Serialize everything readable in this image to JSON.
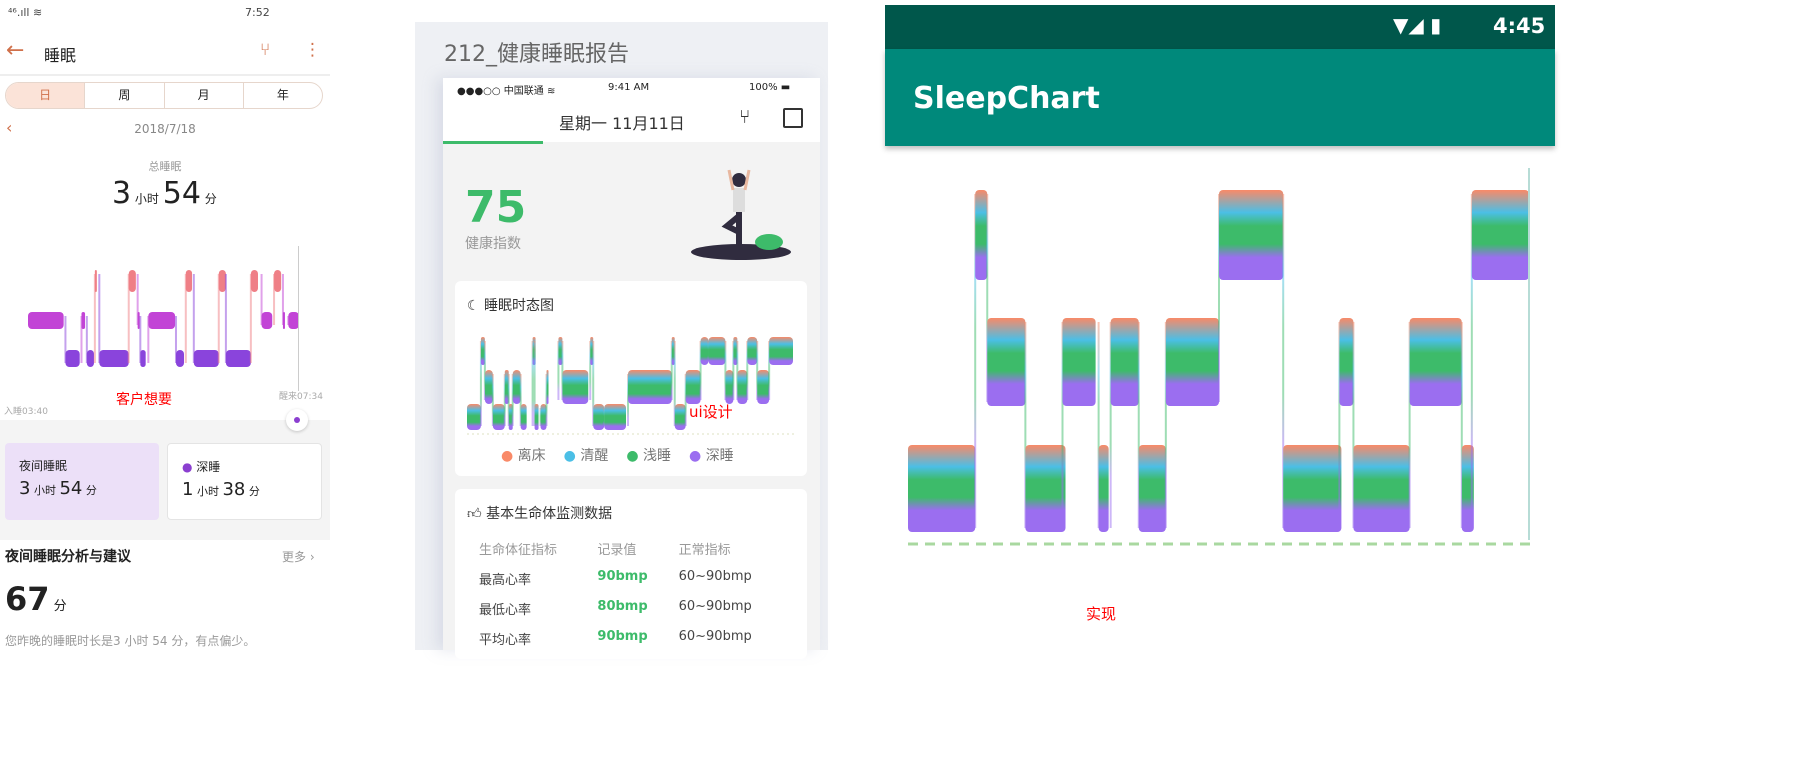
{
  "left": {
    "status_time": "7:52",
    "title": "睡眠",
    "tabs": [
      "日",
      "周",
      "月",
      "年"
    ],
    "date": "2018/7/18",
    "total_label": "总睡眠",
    "total_hours": "3",
    "hour_unit": "小时",
    "total_minutes": "54",
    "minute_unit": "分",
    "sleep_start": "入睡03:40",
    "wake": "醒来07:34",
    "annotation": "客户想要",
    "night_card": {
      "label": "夜间睡眠",
      "hours": "3",
      "minutes": "54"
    },
    "deep_card": {
      "label": "深睡",
      "hours": "1",
      "minutes": "38"
    },
    "analysis_title": "夜间睡眠分析与建议",
    "more": "更多",
    "score": "67",
    "score_unit": "分",
    "advice": "您昨晚的睡眠时长是3 小时 54 分，有点偏少。"
  },
  "middle": {
    "page_title": "212_健康睡眠报告",
    "carrier": "●●●○○ 中国联通",
    "time": "9:41 AM",
    "battery": "100%",
    "date_title": "星期一  11月11日",
    "score": "75",
    "score_label": "健康指数",
    "chart_title": "睡眠时态图",
    "annotation": "ui设计",
    "legend": [
      "离床",
      "清醒",
      "浅睡",
      "深睡"
    ],
    "vitals_title": "基本生命体监测数据",
    "table_headers": [
      "生命体征指标",
      "记录值",
      "正常指标"
    ],
    "table_rows": [
      [
        "最高心率",
        "90bmp",
        "60~90bmp"
      ],
      [
        "最低心率",
        "80bmp",
        "60~90bmp"
      ],
      [
        "平均心率",
        "90bmp",
        "60~90bmp"
      ]
    ]
  },
  "right": {
    "time": "4:45",
    "app_title": "SleepChart",
    "annotation": "实现"
  },
  "colors": {
    "out": "#f98a68",
    "awake": "#4bbfe6",
    "light": "#3dbb6a",
    "deep": "#9b6ef0",
    "accent_green": "#3dbb6a",
    "teal": "#00897b"
  },
  "chart_data": [
    {
      "type": "sleep-stage",
      "name": "left",
      "levels": [
        "out",
        "light",
        "deep"
      ],
      "segments": [
        [
          "light",
          0,
          40
        ],
        [
          "deep",
          42,
          58
        ],
        [
          "light",
          60,
          64
        ],
        [
          "deep",
          66,
          74
        ],
        [
          "out",
          75,
          77
        ],
        [
          "deep",
          80,
          113
        ],
        [
          "out",
          113,
          121
        ],
        [
          "light",
          123,
          125
        ],
        [
          "deep",
          126,
          132
        ],
        [
          "light",
          135,
          165
        ],
        [
          "deep",
          166,
          175
        ],
        [
          "out",
          177,
          184
        ],
        [
          "deep",
          186,
          214
        ],
        [
          "out",
          214,
          222
        ],
        [
          "deep",
          222,
          250
        ],
        [
          "out",
          250,
          258
        ],
        [
          "light",
          262,
          274
        ],
        [
          "out",
          276,
          284
        ],
        [
          "light",
          286,
          288
        ],
        [
          "light",
          292,
          304
        ]
      ]
    },
    {
      "type": "sleep-stage",
      "name": "middle",
      "levels": [
        "out",
        "awake",
        "light",
        "deep"
      ],
      "segments": [
        [
          "deep",
          0,
          14
        ],
        [
          "out",
          14,
          18
        ],
        [
          "light",
          18,
          26
        ],
        [
          "deep",
          26,
          38
        ],
        [
          "light",
          38,
          42
        ],
        [
          "deep",
          42,
          46
        ],
        [
          "light",
          46,
          54
        ],
        [
          "deep",
          54,
          60
        ],
        [
          "awake",
          66,
          69
        ],
        [
          "deep",
          68,
          72
        ],
        [
          "deep",
          74,
          80
        ],
        [
          "light",
          80,
          82
        ],
        [
          "out",
          92,
          96
        ],
        [
          "light",
          96,
          122
        ],
        [
          "out",
          124,
          127
        ],
        [
          "deep",
          127,
          138
        ],
        [
          "deep",
          138,
          160
        ],
        [
          "light",
          162,
          206
        ],
        [
          "out",
          206,
          209
        ],
        [
          "deep",
          209,
          220
        ],
        [
          "light",
          220,
          235
        ],
        [
          "out",
          235,
          243
        ],
        [
          "awake",
          243,
          260
        ],
        [
          "light",
          260,
          268
        ],
        [
          "awake",
          268,
          272
        ],
        [
          "light",
          272,
          282
        ],
        [
          "awake",
          282,
          292
        ],
        [
          "light",
          292,
          304
        ],
        [
          "out",
          304,
          328
        ]
      ]
    },
    {
      "type": "sleep-stage",
      "name": "right",
      "levels": [
        "out",
        "awake",
        "light",
        "deep"
      ],
      "segments": [
        [
          "deep",
          0,
          67
        ],
        [
          "out",
          67,
          79
        ],
        [
          "light",
          79,
          117
        ],
        [
          "deep",
          117,
          157
        ],
        [
          "light",
          154,
          187
        ],
        [
          "deep",
          190,
          200
        ],
        [
          "light",
          202,
          230
        ],
        [
          "deep",
          230,
          257
        ],
        [
          "light",
          257,
          310
        ],
        [
          "awake",
          310,
          374
        ],
        [
          "deep",
          374,
          432
        ],
        [
          "light",
          430,
          444
        ],
        [
          "deep",
          444,
          500
        ],
        [
          "light",
          500,
          552
        ],
        [
          "deep",
          552,
          564
        ],
        [
          "out",
          562,
          619
        ]
      ]
    }
  ]
}
